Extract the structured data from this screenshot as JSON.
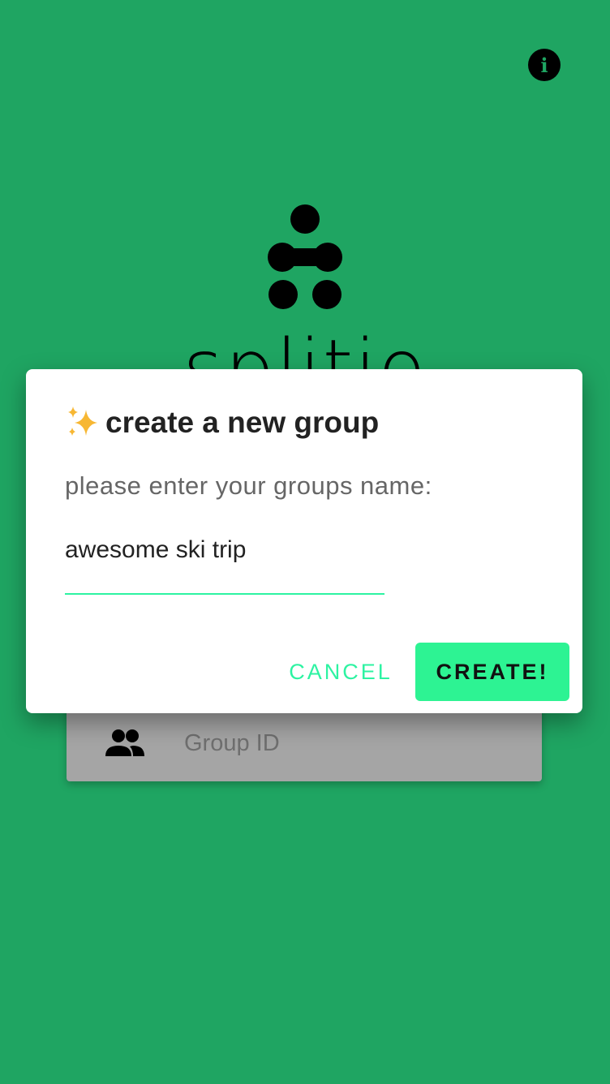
{
  "header": {
    "info_icon": "info-icon",
    "info_glyph": "i"
  },
  "brand": {
    "name": "splitio",
    "logo_icon": "splitio-logo-icon"
  },
  "background_form": {
    "group_icon": "group-icon",
    "group_id_placeholder": "Group ID"
  },
  "dialog": {
    "title_icon": "sparkles-icon",
    "title": "create a new group",
    "prompt": "please enter your groups name:",
    "name_value": "awesome ski trip",
    "cancel_label": "CANCEL",
    "create_label": "CREATE!"
  },
  "colors": {
    "background": "#1fa562",
    "accent": "#2df3a2",
    "primary_button": "#2df393",
    "dialog": "#ffffff"
  }
}
